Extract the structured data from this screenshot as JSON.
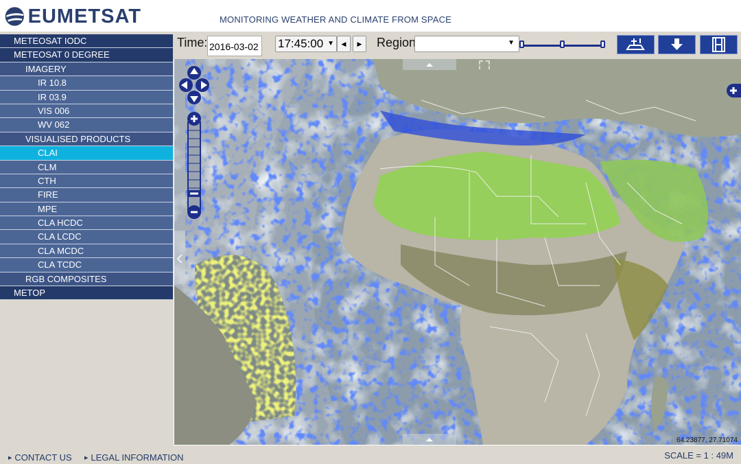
{
  "header": {
    "logo_text": "EUMETSAT",
    "tagline": "MONITORING WEATHER AND CLIMATE FROM SPACE",
    "brand_color": "#2a3f6e"
  },
  "sidebar": {
    "items": [
      {
        "label": "METEOSAT IODC",
        "level": 0
      },
      {
        "label": "METEOSAT 0 DEGREE",
        "level": 0
      },
      {
        "label": "IMAGERY",
        "level": 1
      },
      {
        "label": "IR 10.8",
        "level": 2
      },
      {
        "label": "IR 03.9",
        "level": 2
      },
      {
        "label": "VIS 006",
        "level": 2
      },
      {
        "label": "WV 062",
        "level": 2
      },
      {
        "label": "VISUALISED PRODUCTS",
        "level": 1
      },
      {
        "label": "CLAI",
        "level": 2,
        "selected": true
      },
      {
        "label": "CLM",
        "level": 2
      },
      {
        "label": "CTH",
        "level": 2
      },
      {
        "label": "FIRE",
        "level": 2
      },
      {
        "label": "MPE",
        "level": 2
      },
      {
        "label": "CLA HCDC",
        "level": 2
      },
      {
        "label": "CLA LCDC",
        "level": 2
      },
      {
        "label": "CLA MCDC",
        "level": 2
      },
      {
        "label": "CLA TCDC",
        "level": 2
      },
      {
        "label": "RGB COMPOSITES",
        "level": 1
      },
      {
        "label": "METOP",
        "level": 0
      }
    ],
    "selected_color": "#0fb2df"
  },
  "toolbar": {
    "time_label": "Time:",
    "date_value": "2016-03-02",
    "time_value": "17:45:00",
    "prev_icon": "triangle-left-icon",
    "next_icon": "triangle-right-icon",
    "region_label": "Region",
    "region_value": "",
    "opacity_level": 0.5,
    "buttons": [
      {
        "icon": "layer-add-icon"
      },
      {
        "icon": "download-icon"
      },
      {
        "icon": "film-icon"
      }
    ]
  },
  "map": {
    "coordinates": "64.23877, 27.71074",
    "controls": [
      "pan-control-icon",
      "zoom-in-icon",
      "zoom-out-icon",
      "expand-layers-icon",
      "collapse-panel-icon"
    ]
  },
  "footer": {
    "contact": "CONTACT US",
    "legal": "LEGAL INFORMATION",
    "scale": "SCALE = 1 : 49M"
  }
}
